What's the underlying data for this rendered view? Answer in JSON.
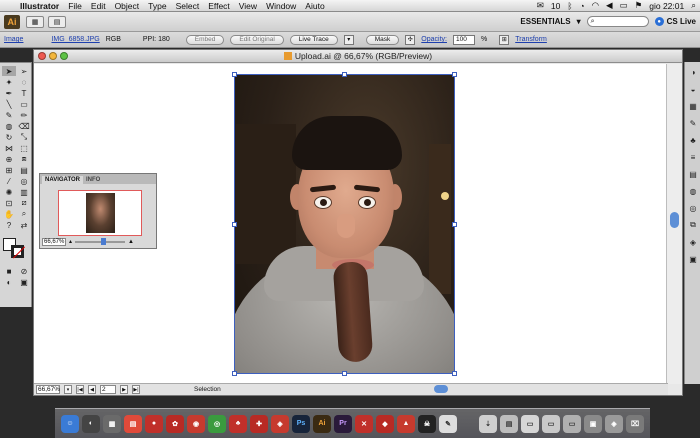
{
  "menubar": {
    "app_name": "Illustrator",
    "items": [
      "File",
      "Edit",
      "Object",
      "Type",
      "Select",
      "Effect",
      "View",
      "Window",
      "Aiuto"
    ],
    "right": {
      "badge": "10",
      "clock": "gio 22:01"
    }
  },
  "appbar": {
    "logo": "Ai",
    "workspace": "ESSENTIALS",
    "cs_live": "CS Live"
  },
  "control": {
    "object_type": "Image",
    "file_name": "IMG_6858.JPG",
    "color_mode": "RGB",
    "ppi_label": "PPI: 180",
    "embed": "Embed",
    "edit_original": "Edit Original",
    "live_trace": "Live Trace",
    "mask": "Mask",
    "opacity_label": "Opacity:",
    "opacity_value": "100",
    "opacity_unit": "%",
    "transform": "Transform"
  },
  "document": {
    "title": "Upload.ai @ 66,67% (RGB/Preview)",
    "zoom": "66,67%",
    "page": "2",
    "status": "Selection"
  },
  "navigator": {
    "tabs": [
      "NAVIGATOR",
      "INFO"
    ],
    "zoom": "66,67%"
  },
  "colors": {
    "selection_blue": "#3d5fbf",
    "illustrator_orange": "#f0a33a",
    "navigator_red": "#e05a5a"
  }
}
